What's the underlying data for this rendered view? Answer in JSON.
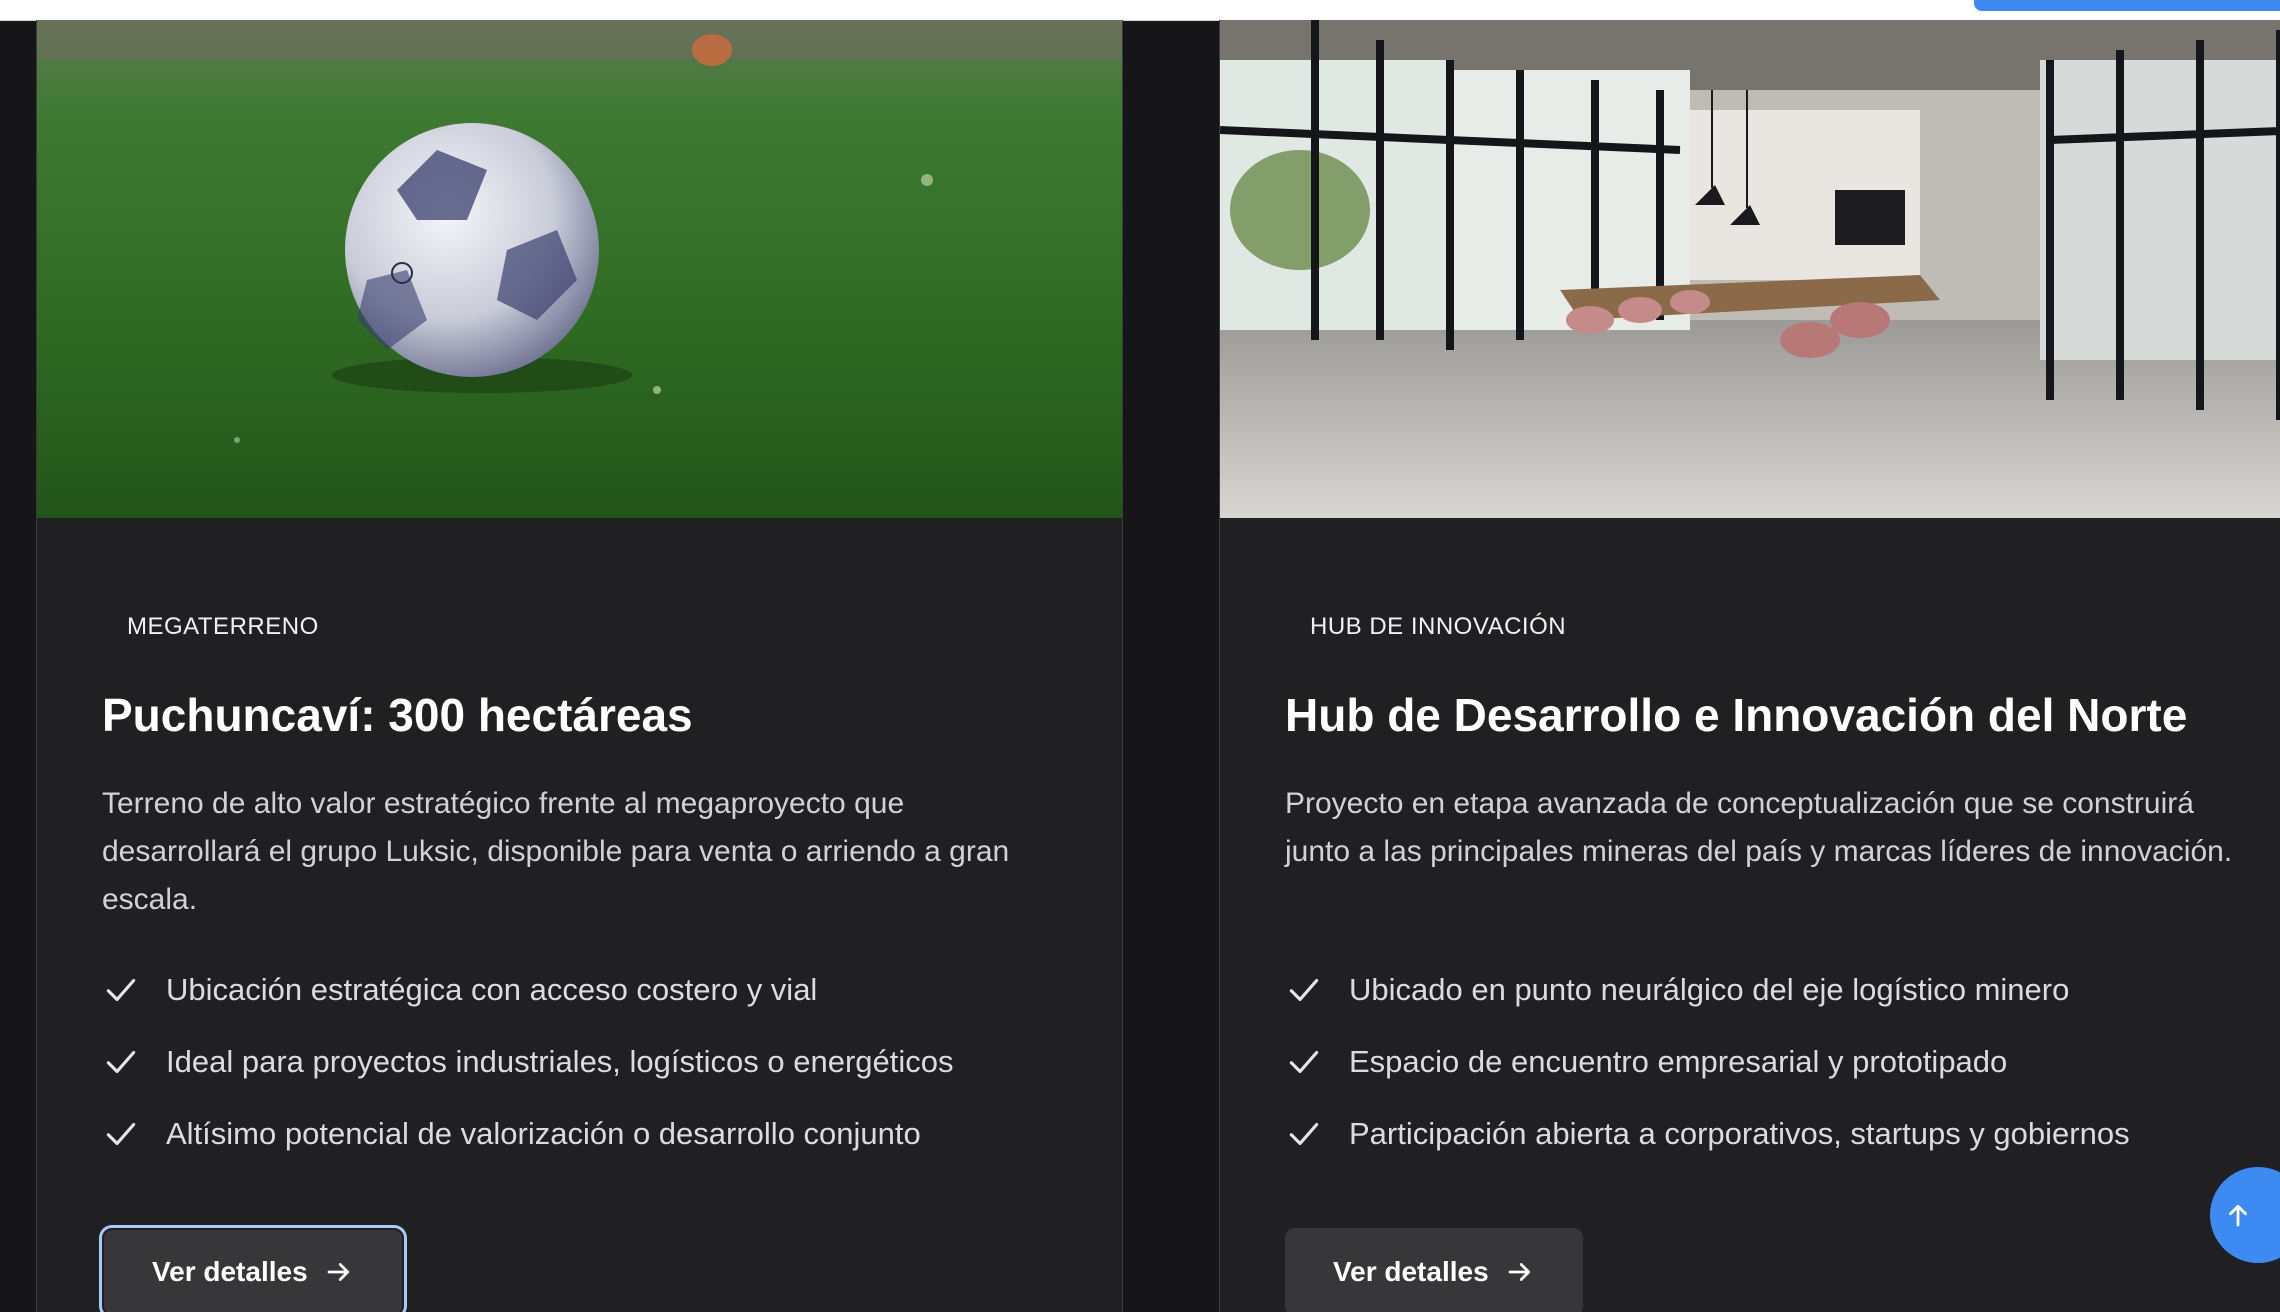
{
  "cards": [
    {
      "image": "soccer-ball-on-grass",
      "category": "MEGATERRENO",
      "title": "Puchuncaví: 300 hectáreas",
      "description": "Terreno de alto valor estratégico frente al megaproyecto que desarrollará el grupo Luksic, disponible para venta o arriendo a gran escala.",
      "features": [
        "Ubicación estratégica con acceso costero y vial",
        "Ideal para proyectos industriales, logísticos o energéticos",
        "Altísimo potencial de valorización o desarrollo conjunto"
      ],
      "button_label": "Ver detalles"
    },
    {
      "image": "modern-meeting-room",
      "category": "HUB DE INNOVACIÓN",
      "title": "Hub de Desarrollo e Innovación del Norte",
      "description": "Proyecto en etapa avanzada de conceptualización que se construirá junto a las principales mineras del país y marcas líderes de innovación.",
      "features": [
        "Ubicado en punto neurálgico del eje logístico minero",
        "Espacio de encuentro empresarial y prototipado",
        "Participación abierta a corporativos, startups y gobiernos"
      ],
      "button_label": "Ver detalles"
    }
  ],
  "icons": {
    "check": "check-icon",
    "arrow": "arrow-right-icon",
    "scroll_top": "arrow-up-icon"
  },
  "colors": {
    "background": "#161618",
    "card": "#202022",
    "button": "#37373a",
    "accent": "#3d8bf2"
  }
}
